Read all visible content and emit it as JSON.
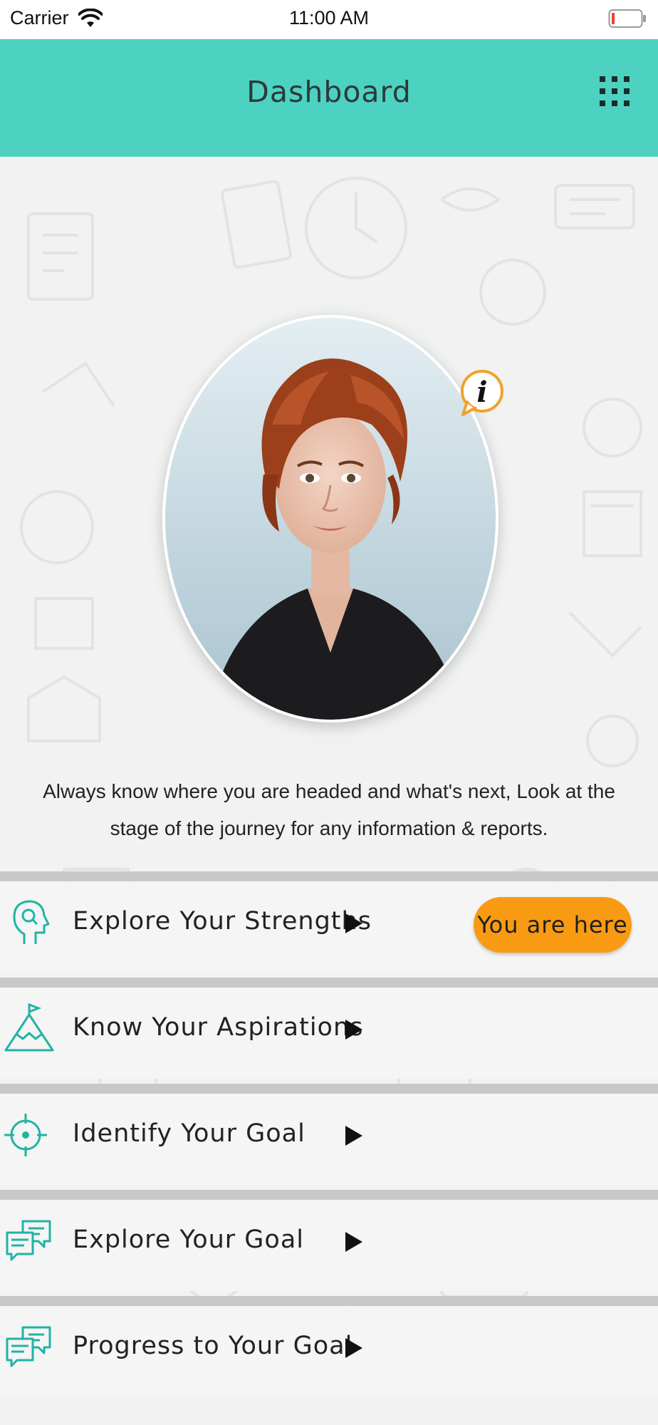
{
  "status_bar": {
    "carrier": "Carrier",
    "time": "11:00 AM"
  },
  "header": {
    "title": "Dashboard",
    "menu_icon": "grid-menu-icon"
  },
  "intro_text": "Always know where you are headed and what's next, Look at the stage of the journey for any information & reports.",
  "stages": [
    {
      "label": "Explore Your Strengths",
      "icon": "head-profile-icon",
      "current": true,
      "badge": "You are here"
    },
    {
      "label": "Know Your Aspirations",
      "icon": "mountain-flag-icon",
      "current": false
    },
    {
      "label": "Identify Your Goal",
      "icon": "target-crosshair-icon",
      "current": false
    },
    {
      "label": "Explore Your Goal",
      "icon": "chat-bubbles-icon",
      "current": false
    },
    {
      "label": "Progress to Your Goal",
      "icon": "chat-bubbles-icon",
      "current": false
    }
  ],
  "colors": {
    "accent": "#4dd2c1",
    "icon_teal": "#21b3a5",
    "badge": "#f89b12"
  }
}
